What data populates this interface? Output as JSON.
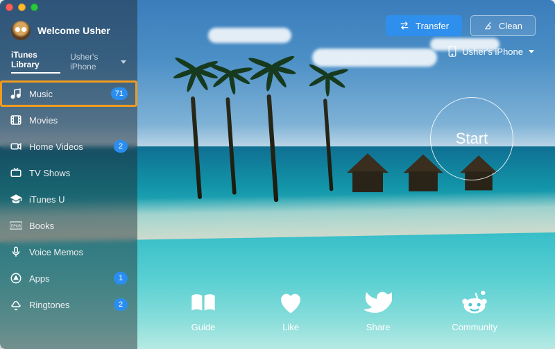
{
  "user": {
    "welcome": "Welcome Usher"
  },
  "tabs": {
    "library": "iTunes Library",
    "device": "Usher's iPhone"
  },
  "sidebar": [
    {
      "id": "music",
      "label": "Music",
      "badge": "71",
      "selected": true,
      "icon": "music-note-icon"
    },
    {
      "id": "movies",
      "label": "Movies",
      "badge": null,
      "selected": false,
      "icon": "film-icon"
    },
    {
      "id": "homevideos",
      "label": "Home Videos",
      "badge": "2",
      "selected": false,
      "icon": "video-camera-icon"
    },
    {
      "id": "tvshows",
      "label": "TV Shows",
      "badge": null,
      "selected": false,
      "icon": "tv-icon"
    },
    {
      "id": "itunesu",
      "label": "iTunes U",
      "badge": null,
      "selected": false,
      "icon": "graduation-cap-icon"
    },
    {
      "id": "books",
      "label": "Books",
      "badge": null,
      "selected": false,
      "icon": "epub-icon"
    },
    {
      "id": "voicememos",
      "label": "Voice Memos",
      "badge": null,
      "selected": false,
      "icon": "microphone-icon"
    },
    {
      "id": "apps",
      "label": "Apps",
      "badge": "1",
      "selected": false,
      "icon": "apps-icon"
    },
    {
      "id": "ringtones",
      "label": "Ringtones",
      "badge": "2",
      "selected": false,
      "icon": "bell-icon"
    }
  ],
  "topbar": {
    "transfer": "Transfer",
    "clean": "Clean",
    "device_label": "Usher's iPhone"
  },
  "start": {
    "label": "Start"
  },
  "bottom": {
    "guide": "Guide",
    "like": "Like",
    "share": "Share",
    "community": "Community"
  }
}
